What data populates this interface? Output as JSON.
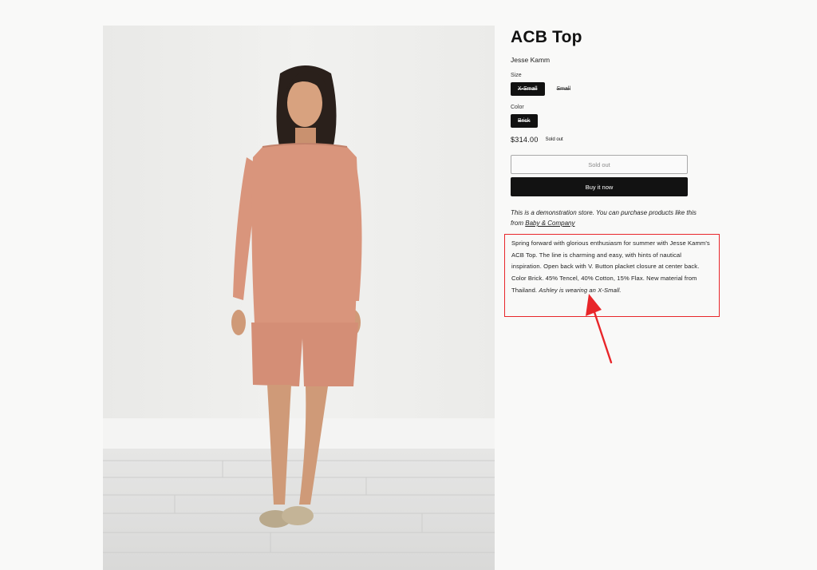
{
  "product": {
    "title": "ACB Top",
    "vendor": "Jesse Kamm",
    "size_label": "Size",
    "sizes": [
      "X-Small",
      "Small"
    ],
    "color_label": "Color",
    "colors": [
      "Brick"
    ],
    "price": "$314.00",
    "badge": "Sold out",
    "sold_out_button": "Sold out",
    "buy_button": "Buy it now",
    "demo_text": "This is a demonstration store. You can purchase products like this from",
    "demo_link": "Baby & Company",
    "description": " Spring forward with glorious enthusiasm for summer with Jesse Kamm's ACB Top. The line is charming and easy, with hints of nautical inspiration. Open back with V. Button placket closure at center back. Color Brick. 45% Tencel, 40% Cotton, 15% Flax. New material from Thailand. ",
    "description_italic": "Ashley is wearing an X-Small."
  },
  "colors": {
    "highlight": "#e8262a",
    "garment": "#d9957c",
    "button_dark": "#121212"
  },
  "icons": {
    "annotation": "red-arrow-icon"
  }
}
